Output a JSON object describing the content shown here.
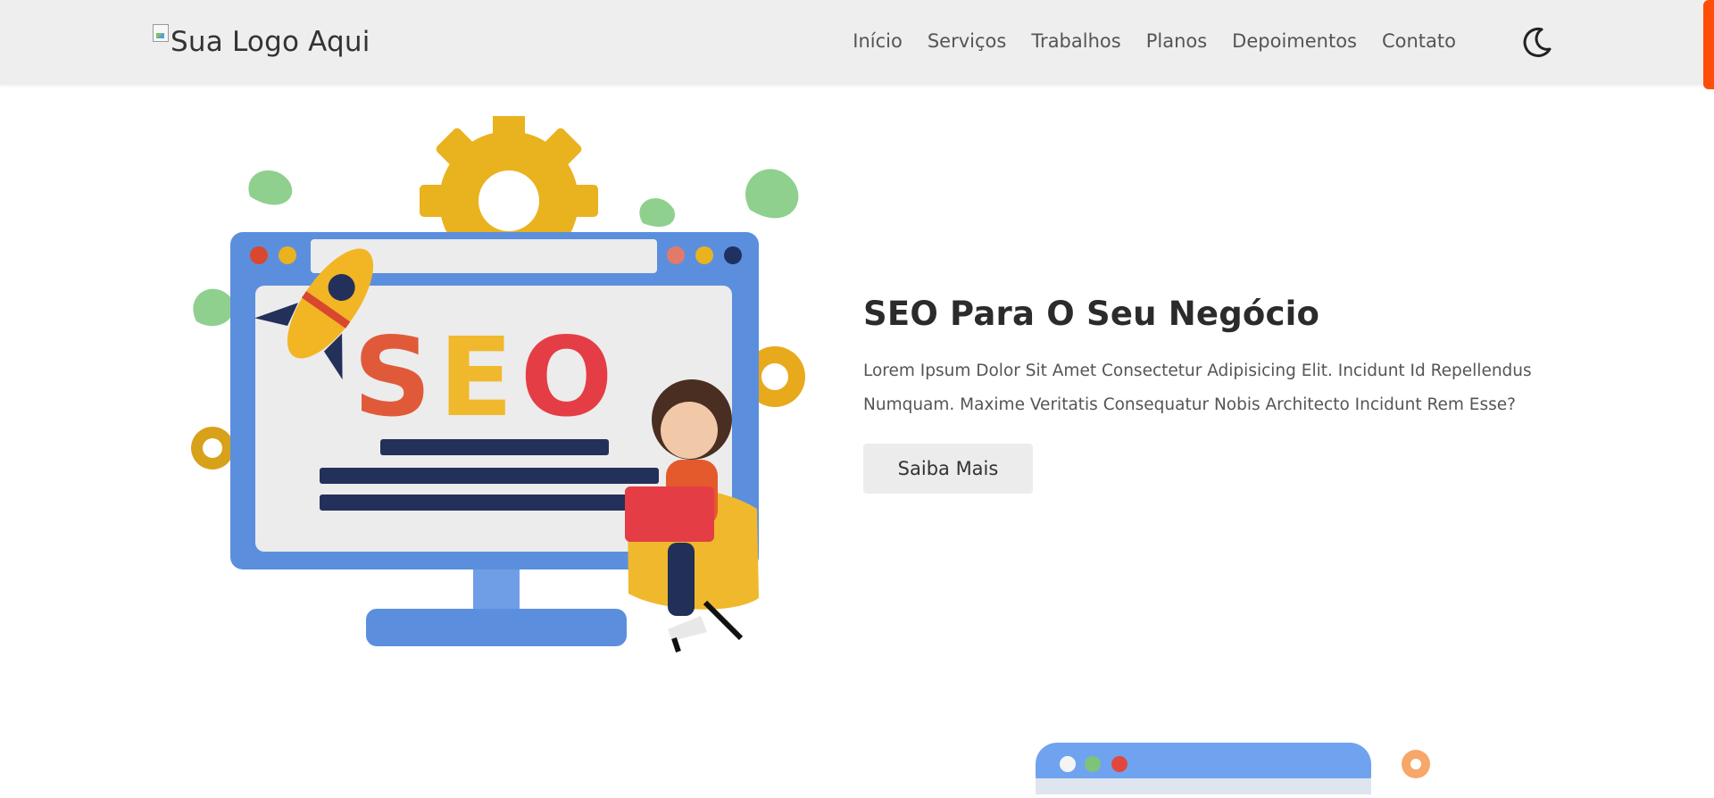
{
  "header": {
    "logo_alt": "Sua Logo Aqui",
    "nav": [
      "Início",
      "Serviços",
      "Trabalhos",
      "Planos",
      "Depoimentos",
      "Contato"
    ],
    "theme_icon": "moon-icon"
  },
  "hero": {
    "illustration_text": "SEO",
    "title": "SEO Para O Seu Negócio",
    "description": "Lorem Ipsum Dolor Sit Amet Consectetur Adipisicing Elit. Incidunt Id Repellendus Numquam. Maxime Veritatis Consequatur Nobis Architecto Incidunt Rem Esse?",
    "button": "Saiba Mais"
  },
  "colors": {
    "accent": "#ff4d0a",
    "header_bg": "#eeeeee",
    "button_bg": "#ececec",
    "monitor_blue": "#5b8fde",
    "seo_red": "#e05a3a",
    "seo_yellow": "#f0b82c"
  }
}
